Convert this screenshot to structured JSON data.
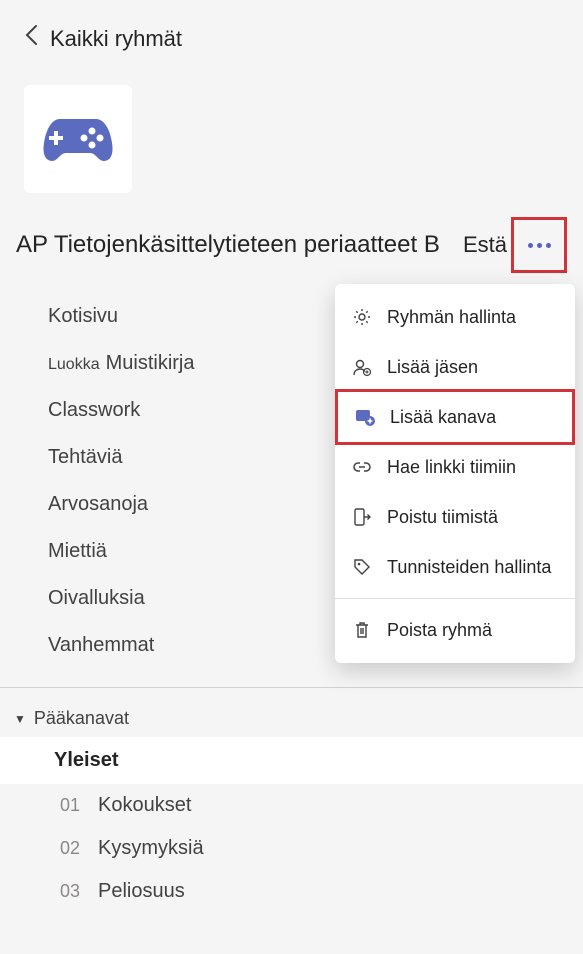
{
  "header": {
    "title": "Kaikki ryhmät"
  },
  "team": {
    "name": "AP Tietojenkäsittelytieteen periaatteet B",
    "block": "Estä"
  },
  "nav": {
    "items": [
      {
        "label": "Kotisivu"
      },
      {
        "prefix": "Luokka",
        "label": "Muistikirja"
      },
      {
        "label": "Classwork"
      },
      {
        "label": "Tehtäviä"
      },
      {
        "label": "Arvosanoja"
      },
      {
        "label": "Miettiä"
      },
      {
        "label": "Oivalluksia"
      },
      {
        "label": "Vanhemmat"
      }
    ]
  },
  "channels": {
    "section_label": "Pääkanavat",
    "general": "Yleiset",
    "list": [
      {
        "num": "01",
        "name": "Kokoukset"
      },
      {
        "num": "02",
        "name": "Kysymyksiä"
      },
      {
        "num": "03",
        "name": "Peliosuus"
      }
    ]
  },
  "menu": {
    "manage": "Ryhmän hallinta",
    "add_member": "Lisää jäsen",
    "add_channel": "Lisää kanava",
    "get_link": "Hae linkki tiimiin",
    "leave": "Poistu tiimistä",
    "tags": "Tunnisteiden hallinta",
    "delete": "Poista ryhmä"
  }
}
